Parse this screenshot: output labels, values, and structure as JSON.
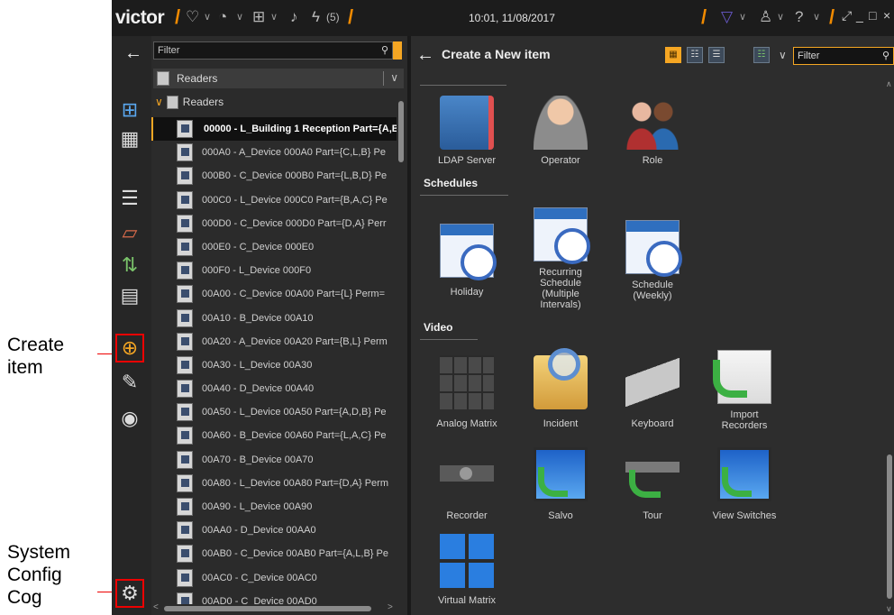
{
  "callouts": {
    "create_item": [
      "Create",
      "item"
    ],
    "system_config": [
      "System",
      "Config",
      "Cog"
    ]
  },
  "topbar": {
    "brand": "victor",
    "slash": "/",
    "alarm_count": "(5)",
    "datetime": "10:01, 11/08/2017",
    "icons": [
      "heart-icon",
      "dashboard-icon",
      "layout-icon",
      "bell-icon",
      "lightning-icon",
      "filter-icon",
      "user-icon",
      "help-icon"
    ]
  },
  "tree": {
    "filter_placeholder": "Filter",
    "selector_label": "Readers",
    "root_label": "Readers",
    "rows": [
      "00000 - L_Building 1 Reception Part={A,B",
      "000A0 - A_Device 000A0 Part={C,L,B} Pe",
      "000B0 - C_Device 000B0 Part={L,B,D} Pe",
      "000C0 - L_Device 000C0 Part={B,A,C} Pe",
      "000D0 - C_Device 000D0 Part={D,A} Perr",
      "000E0 - C_Device 000E0",
      "000F0 - L_Device 000F0",
      "00A00 - C_Device 00A00 Part={L} Perm=",
      "00A10 - B_Device 00A10",
      "00A20 - A_Device 00A20 Part={B,L} Perm",
      "00A30 - L_Device 00A30",
      "00A40 - D_Device 00A40",
      "00A50 - L_Device 00A50 Part={A,D,B} Pe",
      "00A60 - B_Device 00A60 Part={L,A,C} Pe",
      "00A70 - B_Device 00A70",
      "00A80 - L_Device 00A80 Part={D,A} Perm",
      "00A90 - L_Device 00A90",
      "00AA0 - D_Device 00AA0",
      "00AB0 - C_Device 00AB0 Part={A,L,B} Pe",
      "00AC0 - C_Device 00AC0",
      "00AD0 - C_Device 00AD0"
    ]
  },
  "panel": {
    "title": "Create a New item",
    "filter_placeholder": "Filter",
    "top_dot": "·",
    "sections": {
      "schedules": "Schedules",
      "video": "Video"
    },
    "tiles": {
      "ldap": "LDAP Server",
      "operator": "Operator",
      "role": "Role",
      "holiday": "Holiday",
      "recurring": [
        "Recurring",
        "Schedule",
        "(Multiple",
        "Intervals)"
      ],
      "weekly": [
        "Schedule",
        "(Weekly)"
      ],
      "analog_matrix": "Analog Matrix",
      "incident": "Incident",
      "keyboard": "Keyboard",
      "import_recorders": [
        "Import",
        "Recorders"
      ],
      "recorder": "Recorder",
      "salvo": "Salvo",
      "tour": "Tour",
      "view_switches": "View Switches",
      "virtual_matrix": "Virtual Matrix"
    }
  },
  "colors": {
    "accent": "#f5a623",
    "highlight_box": "#ee0000",
    "background": "#2d2d2d"
  }
}
